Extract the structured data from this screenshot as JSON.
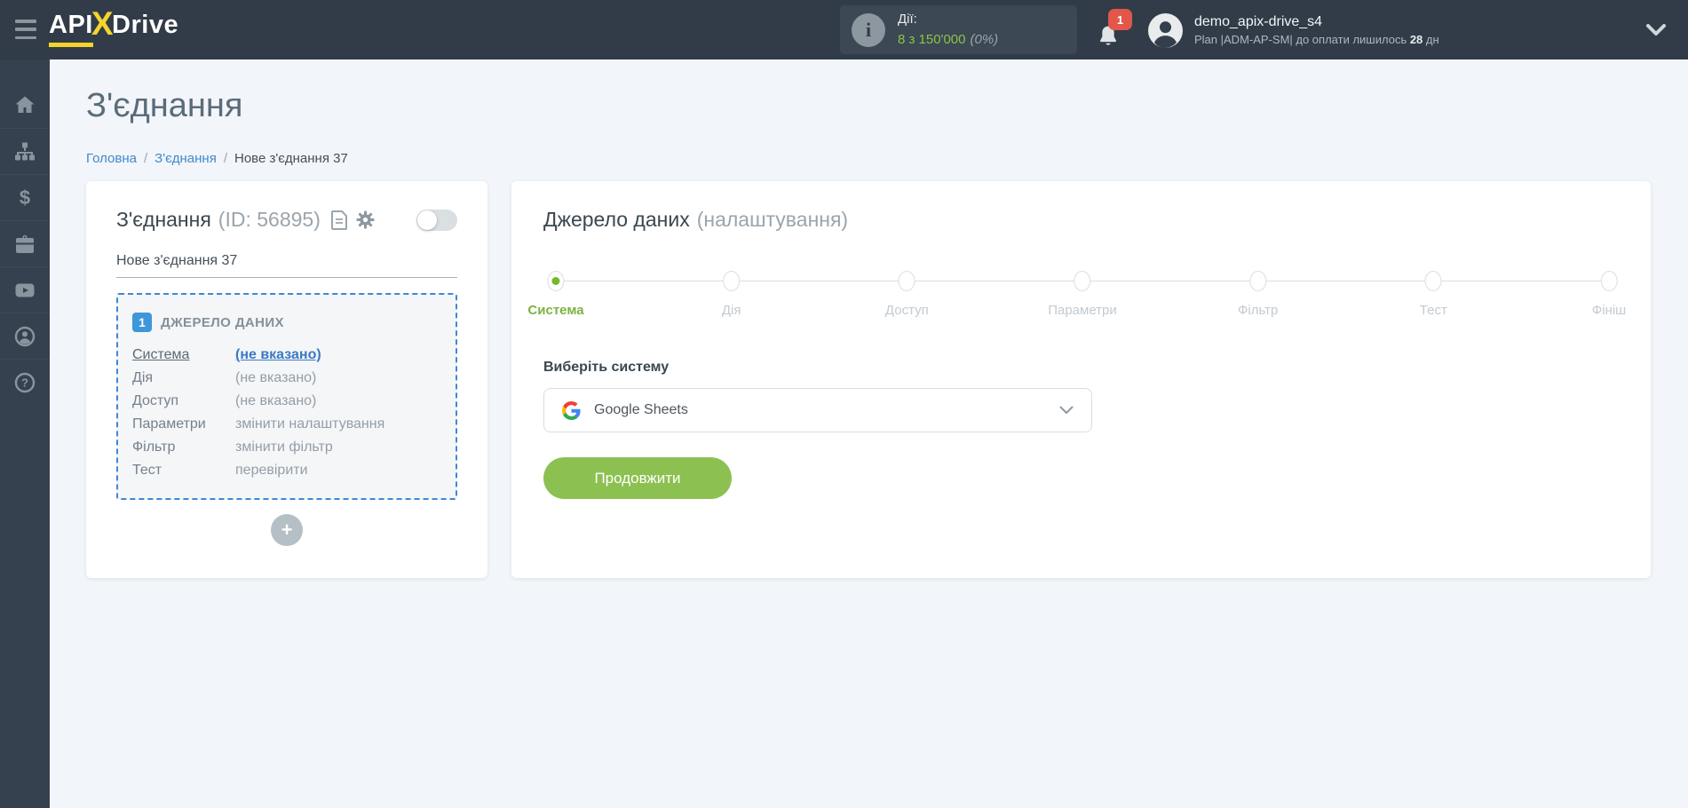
{
  "header": {
    "logo": {
      "part1": "API",
      "x": "X",
      "part2": "Drive"
    },
    "usage": {
      "label": "Дії:",
      "value": "8 з 150'000",
      "percent": "(0%)"
    },
    "notifications": {
      "count": "1"
    },
    "user": {
      "name": "demo_apix-drive_s4",
      "plan_prefix": "Plan |ADM-AP-SM| до оплати лишилось ",
      "days": "28",
      "plan_suffix": " дн"
    }
  },
  "sidebar": {
    "items": [
      {
        "id": "home",
        "icon": "home-icon"
      },
      {
        "id": "connections",
        "icon": "sitemap-icon"
      },
      {
        "id": "billing",
        "icon": "dollar-icon"
      },
      {
        "id": "services",
        "icon": "briefcase-icon"
      },
      {
        "id": "video",
        "icon": "youtube-icon"
      },
      {
        "id": "account",
        "icon": "person-icon"
      },
      {
        "id": "help",
        "icon": "question-icon"
      }
    ]
  },
  "page": {
    "title": "З'єднання",
    "breadcrumb": [
      {
        "label": "Головна",
        "link": true
      },
      {
        "label": "З'єднання",
        "link": true
      },
      {
        "label": "Нове з'єднання 37",
        "link": false
      }
    ]
  },
  "connection_card": {
    "title": "З'єднання",
    "id_text": "(ID: 56895)",
    "name": "Нове з'єднання 37",
    "source_block": {
      "badge": "1",
      "title": "ДЖЕРЕЛО ДАНИХ",
      "rows": [
        {
          "label": "Система",
          "value": "(не вказано)",
          "label_underline": true,
          "value_link": true
        },
        {
          "label": "Дія",
          "value": "(не вказано)"
        },
        {
          "label": "Доступ",
          "value": "(не вказано)"
        },
        {
          "label": "Параметри",
          "value": "змінити налаштування"
        },
        {
          "label": "Фільтр",
          "value": "змінити фільтр"
        },
        {
          "label": "Тест",
          "value": "перевірити"
        }
      ]
    },
    "add_button": "+"
  },
  "settings_card": {
    "title": "Джерело даних",
    "subtitle": "(налаштування)",
    "steps": [
      {
        "label": "Система",
        "active": true
      },
      {
        "label": "Дія"
      },
      {
        "label": "Доступ"
      },
      {
        "label": "Параметри"
      },
      {
        "label": "Фільтр"
      },
      {
        "label": "Тест"
      },
      {
        "label": "Фініш"
      }
    ],
    "select_label": "Виберіть систему",
    "selected_system": "Google Sheets",
    "continue_button": "Продовжити"
  },
  "colors": {
    "header_dark": "#313c48",
    "sidebar_dark": "#36414f",
    "accent_green": "#8bc34a",
    "button_green": "#8cc152",
    "link_blue": "#4189c9",
    "dashed_blue": "#3e87d8",
    "badge_blue": "#3e97d9",
    "notification_red": "#e25749",
    "background": "#f2f5f9"
  }
}
